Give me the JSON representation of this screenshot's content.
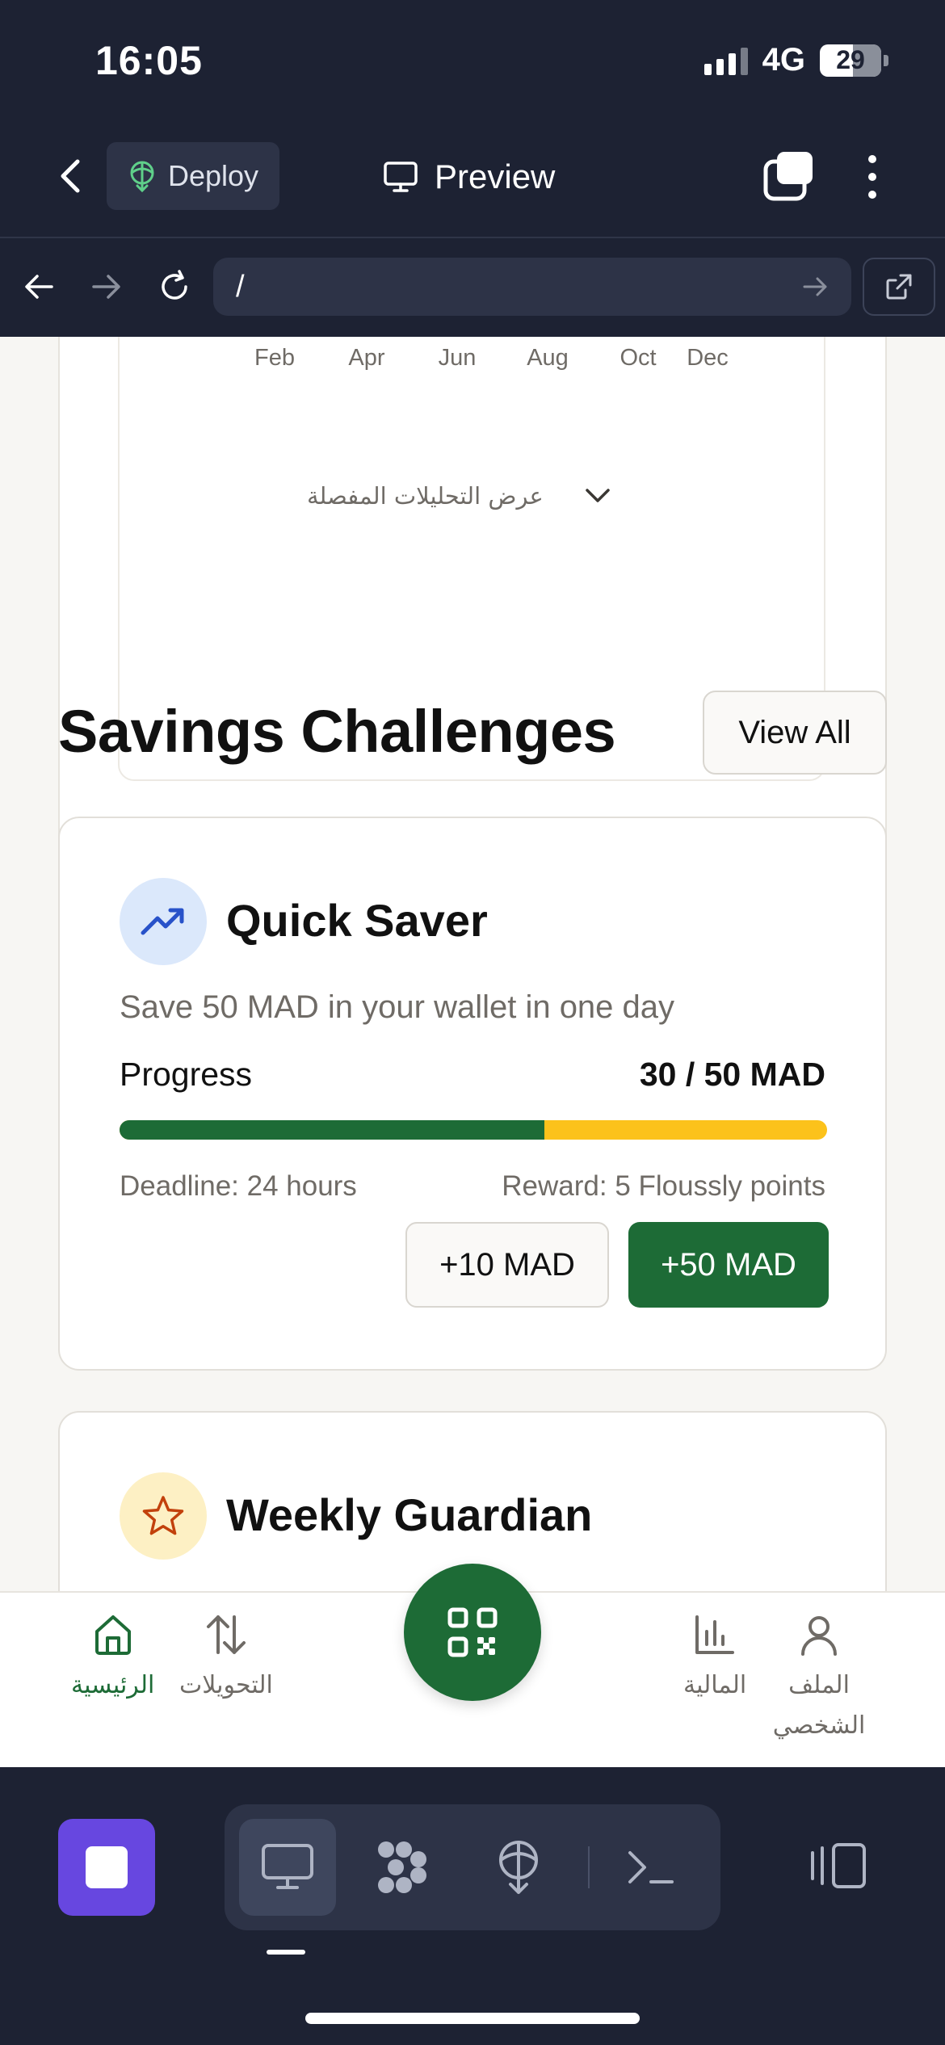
{
  "status_bar": {
    "time": "16:05",
    "network": "4G",
    "battery": "29"
  },
  "app_bar": {
    "deploy_label": "Deploy",
    "preview_label": "Preview"
  },
  "browser": {
    "url": "/"
  },
  "chart": {
    "months": [
      "Feb",
      "Apr",
      "Jun",
      "Aug",
      "Oct",
      "Dec"
    ]
  },
  "details_toggle": {
    "label": "عرض التحليلات المفصلة"
  },
  "savings": {
    "title": "Savings Challenges",
    "view_all": "View All",
    "challenges": [
      {
        "title": "Quick Saver",
        "description": "Save 50 MAD in your wallet in one day",
        "progress_label": "Progress",
        "progress_value": "30 / 50 MAD",
        "progress_fraction": 0.6,
        "deadline": "Deadline: 24 hours",
        "reward": "Reward: 5 Flouss​ly points",
        "add_small": "+10 MAD",
        "add_large": "+50 MAD",
        "icon": "trending-up-icon"
      },
      {
        "title": "Weekly Guardian",
        "icon": "star-icon"
      }
    ]
  },
  "bottom_nav": {
    "home": "الرئيسية",
    "transfers": "التحويلات",
    "finance": "المالية",
    "profile": "الملف الشخصي"
  },
  "colors": {
    "brand_green": "#1d6b36",
    "progress_yellow": "#fcc21b",
    "dark_chrome": "#1d2233",
    "stop_purple": "#6747e0"
  }
}
